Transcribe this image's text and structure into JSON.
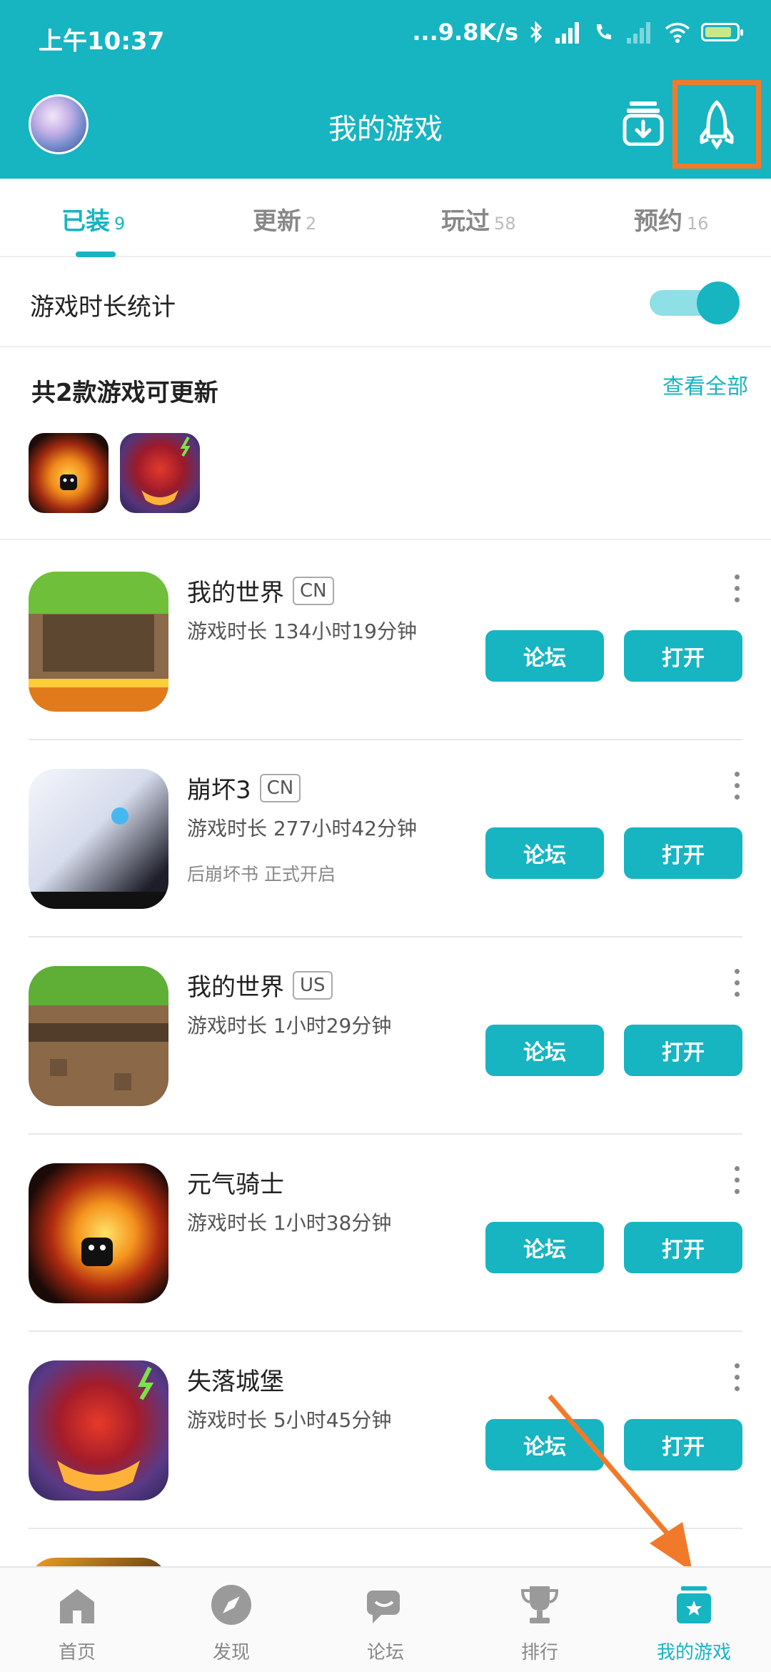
{
  "status": {
    "time": "上午10:37",
    "net_speed": "...9.8K/s",
    "icons": [
      "bluetooth-icon",
      "hd-signal-icon",
      "call-icon",
      "signal-icon",
      "wifi-icon",
      "battery-icon"
    ],
    "battery_level": 0.85
  },
  "header": {
    "title": "我的游戏",
    "icons": [
      "avatar",
      "download-manager-icon",
      "rocket-icon"
    ]
  },
  "tabs": [
    {
      "label": "已装",
      "count": "9",
      "active": true
    },
    {
      "label": "更新",
      "count": "2",
      "active": false
    },
    {
      "label": "玩过",
      "count": "58",
      "active": false
    },
    {
      "label": "预约",
      "count": "16",
      "active": false
    }
  ],
  "stats": {
    "label": "游戏时长统计",
    "enabled": true
  },
  "updates": {
    "title": "共2款游戏可更新",
    "view_all": "查看全部"
  },
  "games": [
    {
      "name": "我的世界",
      "region": "CN",
      "playtime": "游戏时长 134小时19分钟",
      "note": "",
      "forum": "论坛",
      "open": "打开"
    },
    {
      "name": "崩坏3",
      "region": "CN",
      "playtime": "游戏时长 277小时42分钟",
      "note": "后崩坏书 正式开启",
      "forum": "论坛",
      "open": "打开"
    },
    {
      "name": "我的世界",
      "region": "US",
      "playtime": "游戏时长 1小时29分钟",
      "note": "",
      "forum": "论坛",
      "open": "打开"
    },
    {
      "name": "元气骑士",
      "region": "",
      "playtime": "游戏时长 1小时38分钟",
      "note": "",
      "forum": "论坛",
      "open": "打开"
    },
    {
      "name": "失落城堡",
      "region": "",
      "playtime": "游戏时长 5小时45分钟",
      "note": "",
      "forum": "论坛",
      "open": "打开"
    }
  ],
  "bottom_nav": [
    {
      "label": "首页",
      "icon": "home-icon",
      "active": false
    },
    {
      "label": "发现",
      "icon": "compass-icon",
      "active": false
    },
    {
      "label": "论坛",
      "icon": "chat-icon",
      "active": false
    },
    {
      "label": "排行",
      "icon": "trophy-icon",
      "active": false
    },
    {
      "label": "我的游戏",
      "icon": "my-games-icon",
      "active": true
    }
  ],
  "colors": {
    "accent": "#17b4c2",
    "highlight": "#f07a2a"
  }
}
